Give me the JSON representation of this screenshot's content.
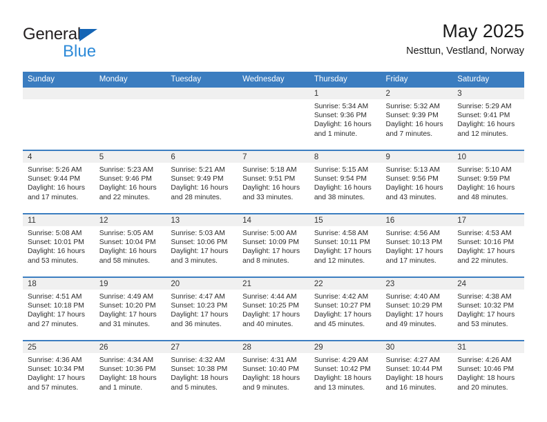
{
  "logo": {
    "name_part1": "General",
    "name_part2": "Blue",
    "triangle_color": "#1565b5",
    "blue_color": "#2d8ad8"
  },
  "header": {
    "title": "May 2025",
    "location": "Nesttun, Vestland, Norway"
  },
  "theme": {
    "header_blue": "#3b7dc0",
    "daynum_band": "#f0f0f0",
    "text": "#2b2b2b"
  },
  "weekdays": [
    "Sunday",
    "Monday",
    "Tuesday",
    "Wednesday",
    "Thursday",
    "Friday",
    "Saturday"
  ],
  "weeks": [
    [
      {
        "day": "",
        "sunrise": "",
        "sunset": "",
        "daylight1": "",
        "daylight2": "",
        "empty": true
      },
      {
        "day": "",
        "sunrise": "",
        "sunset": "",
        "daylight1": "",
        "daylight2": "",
        "empty": true
      },
      {
        "day": "",
        "sunrise": "",
        "sunset": "",
        "daylight1": "",
        "daylight2": "",
        "empty": true
      },
      {
        "day": "",
        "sunrise": "",
        "sunset": "",
        "daylight1": "",
        "daylight2": "",
        "empty": true
      },
      {
        "day": "1",
        "sunrise": "Sunrise: 5:34 AM",
        "sunset": "Sunset: 9:36 PM",
        "daylight1": "Daylight: 16 hours",
        "daylight2": "and 1 minute."
      },
      {
        "day": "2",
        "sunrise": "Sunrise: 5:32 AM",
        "sunset": "Sunset: 9:39 PM",
        "daylight1": "Daylight: 16 hours",
        "daylight2": "and 7 minutes."
      },
      {
        "day": "3",
        "sunrise": "Sunrise: 5:29 AM",
        "sunset": "Sunset: 9:41 PM",
        "daylight1": "Daylight: 16 hours",
        "daylight2": "and 12 minutes."
      }
    ],
    [
      {
        "day": "4",
        "sunrise": "Sunrise: 5:26 AM",
        "sunset": "Sunset: 9:44 PM",
        "daylight1": "Daylight: 16 hours",
        "daylight2": "and 17 minutes."
      },
      {
        "day": "5",
        "sunrise": "Sunrise: 5:23 AM",
        "sunset": "Sunset: 9:46 PM",
        "daylight1": "Daylight: 16 hours",
        "daylight2": "and 22 minutes."
      },
      {
        "day": "6",
        "sunrise": "Sunrise: 5:21 AM",
        "sunset": "Sunset: 9:49 PM",
        "daylight1": "Daylight: 16 hours",
        "daylight2": "and 28 minutes."
      },
      {
        "day": "7",
        "sunrise": "Sunrise: 5:18 AM",
        "sunset": "Sunset: 9:51 PM",
        "daylight1": "Daylight: 16 hours",
        "daylight2": "and 33 minutes."
      },
      {
        "day": "8",
        "sunrise": "Sunrise: 5:15 AM",
        "sunset": "Sunset: 9:54 PM",
        "daylight1": "Daylight: 16 hours",
        "daylight2": "and 38 minutes."
      },
      {
        "day": "9",
        "sunrise": "Sunrise: 5:13 AM",
        "sunset": "Sunset: 9:56 PM",
        "daylight1": "Daylight: 16 hours",
        "daylight2": "and 43 minutes."
      },
      {
        "day": "10",
        "sunrise": "Sunrise: 5:10 AM",
        "sunset": "Sunset: 9:59 PM",
        "daylight1": "Daylight: 16 hours",
        "daylight2": "and 48 minutes."
      }
    ],
    [
      {
        "day": "11",
        "sunrise": "Sunrise: 5:08 AM",
        "sunset": "Sunset: 10:01 PM",
        "daylight1": "Daylight: 16 hours",
        "daylight2": "and 53 minutes."
      },
      {
        "day": "12",
        "sunrise": "Sunrise: 5:05 AM",
        "sunset": "Sunset: 10:04 PM",
        "daylight1": "Daylight: 16 hours",
        "daylight2": "and 58 minutes."
      },
      {
        "day": "13",
        "sunrise": "Sunrise: 5:03 AM",
        "sunset": "Sunset: 10:06 PM",
        "daylight1": "Daylight: 17 hours",
        "daylight2": "and 3 minutes."
      },
      {
        "day": "14",
        "sunrise": "Sunrise: 5:00 AM",
        "sunset": "Sunset: 10:09 PM",
        "daylight1": "Daylight: 17 hours",
        "daylight2": "and 8 minutes."
      },
      {
        "day": "15",
        "sunrise": "Sunrise: 4:58 AM",
        "sunset": "Sunset: 10:11 PM",
        "daylight1": "Daylight: 17 hours",
        "daylight2": "and 12 minutes."
      },
      {
        "day": "16",
        "sunrise": "Sunrise: 4:56 AM",
        "sunset": "Sunset: 10:13 PM",
        "daylight1": "Daylight: 17 hours",
        "daylight2": "and 17 minutes."
      },
      {
        "day": "17",
        "sunrise": "Sunrise: 4:53 AM",
        "sunset": "Sunset: 10:16 PM",
        "daylight1": "Daylight: 17 hours",
        "daylight2": "and 22 minutes."
      }
    ],
    [
      {
        "day": "18",
        "sunrise": "Sunrise: 4:51 AM",
        "sunset": "Sunset: 10:18 PM",
        "daylight1": "Daylight: 17 hours",
        "daylight2": "and 27 minutes."
      },
      {
        "day": "19",
        "sunrise": "Sunrise: 4:49 AM",
        "sunset": "Sunset: 10:20 PM",
        "daylight1": "Daylight: 17 hours",
        "daylight2": "and 31 minutes."
      },
      {
        "day": "20",
        "sunrise": "Sunrise: 4:47 AM",
        "sunset": "Sunset: 10:23 PM",
        "daylight1": "Daylight: 17 hours",
        "daylight2": "and 36 minutes."
      },
      {
        "day": "21",
        "sunrise": "Sunrise: 4:44 AM",
        "sunset": "Sunset: 10:25 PM",
        "daylight1": "Daylight: 17 hours",
        "daylight2": "and 40 minutes."
      },
      {
        "day": "22",
        "sunrise": "Sunrise: 4:42 AM",
        "sunset": "Sunset: 10:27 PM",
        "daylight1": "Daylight: 17 hours",
        "daylight2": "and 45 minutes."
      },
      {
        "day": "23",
        "sunrise": "Sunrise: 4:40 AM",
        "sunset": "Sunset: 10:29 PM",
        "daylight1": "Daylight: 17 hours",
        "daylight2": "and 49 minutes."
      },
      {
        "day": "24",
        "sunrise": "Sunrise: 4:38 AM",
        "sunset": "Sunset: 10:32 PM",
        "daylight1": "Daylight: 17 hours",
        "daylight2": "and 53 minutes."
      }
    ],
    [
      {
        "day": "25",
        "sunrise": "Sunrise: 4:36 AM",
        "sunset": "Sunset: 10:34 PM",
        "daylight1": "Daylight: 17 hours",
        "daylight2": "and 57 minutes."
      },
      {
        "day": "26",
        "sunrise": "Sunrise: 4:34 AM",
        "sunset": "Sunset: 10:36 PM",
        "daylight1": "Daylight: 18 hours",
        "daylight2": "and 1 minute."
      },
      {
        "day": "27",
        "sunrise": "Sunrise: 4:32 AM",
        "sunset": "Sunset: 10:38 PM",
        "daylight1": "Daylight: 18 hours",
        "daylight2": "and 5 minutes."
      },
      {
        "day": "28",
        "sunrise": "Sunrise: 4:31 AM",
        "sunset": "Sunset: 10:40 PM",
        "daylight1": "Daylight: 18 hours",
        "daylight2": "and 9 minutes."
      },
      {
        "day": "29",
        "sunrise": "Sunrise: 4:29 AM",
        "sunset": "Sunset: 10:42 PM",
        "daylight1": "Daylight: 18 hours",
        "daylight2": "and 13 minutes."
      },
      {
        "day": "30",
        "sunrise": "Sunrise: 4:27 AM",
        "sunset": "Sunset: 10:44 PM",
        "daylight1": "Daylight: 18 hours",
        "daylight2": "and 16 minutes."
      },
      {
        "day": "31",
        "sunrise": "Sunrise: 4:26 AM",
        "sunset": "Sunset: 10:46 PM",
        "daylight1": "Daylight: 18 hours",
        "daylight2": "and 20 minutes."
      }
    ]
  ]
}
